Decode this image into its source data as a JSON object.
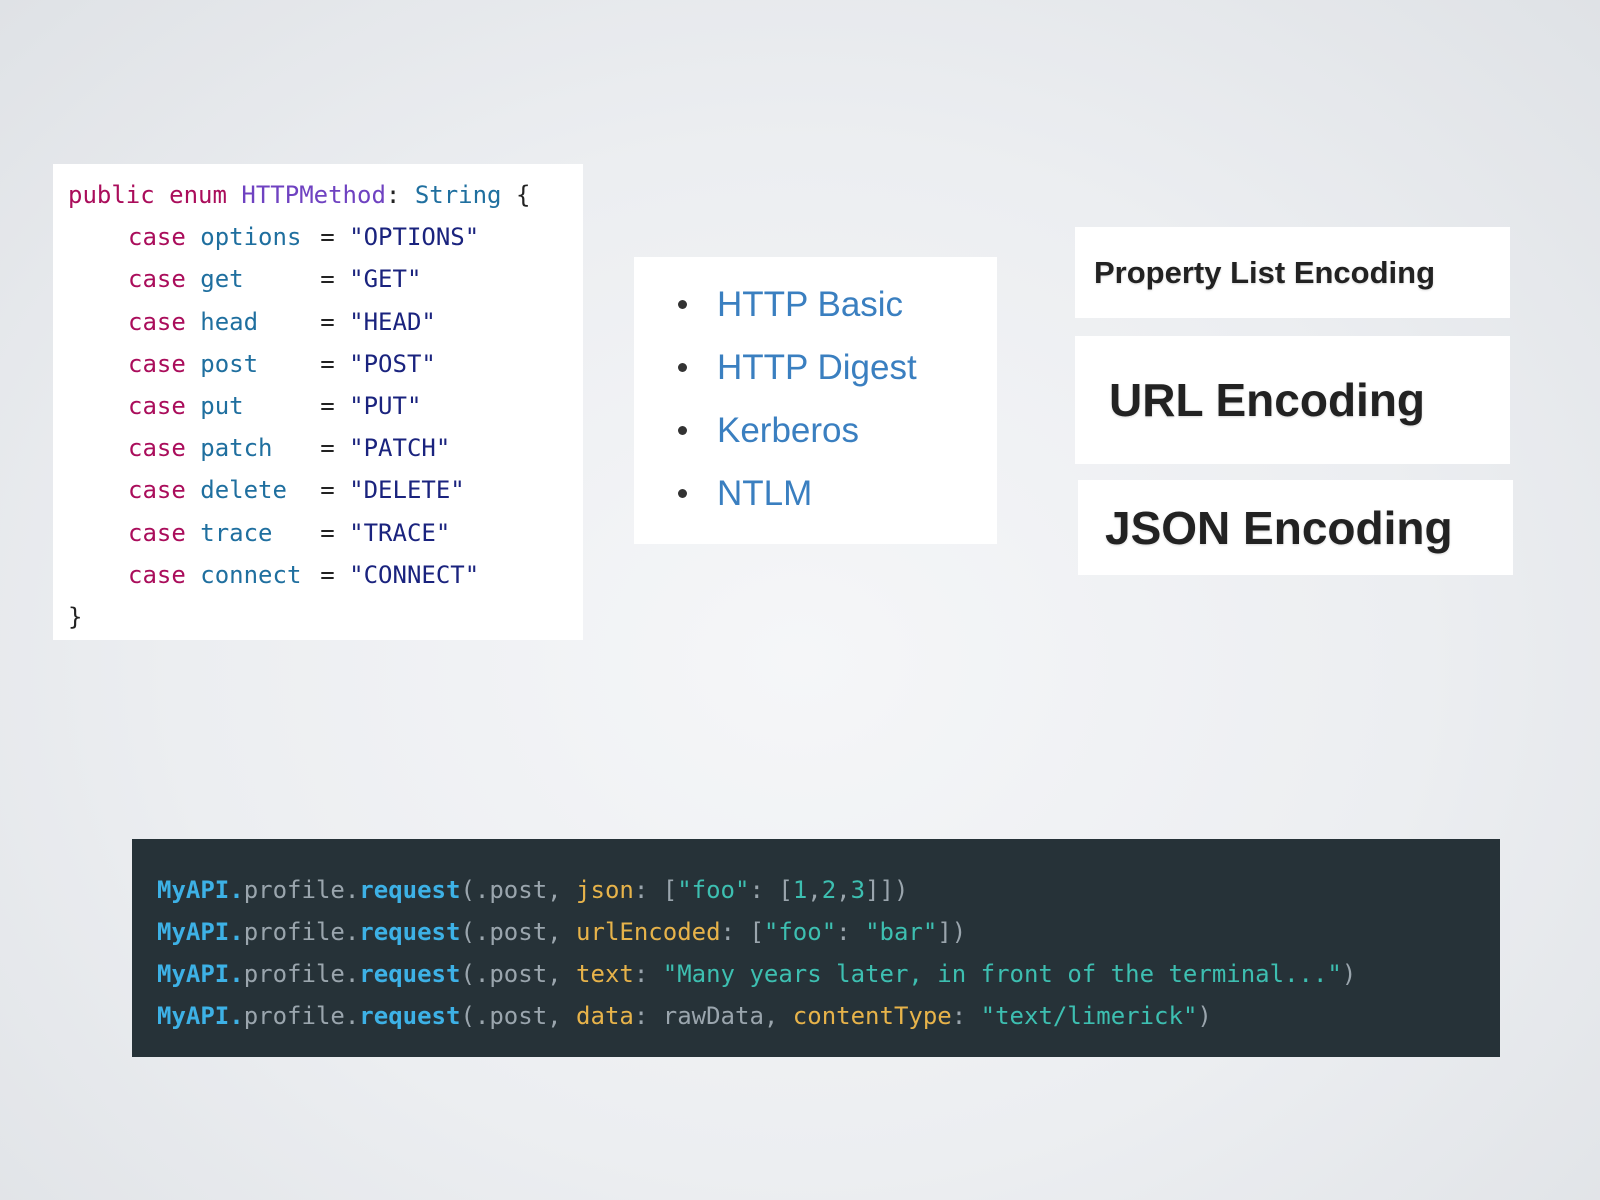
{
  "enum_code": {
    "header": {
      "kw1": "public",
      "kw2": "enum",
      "type_name": "HTTPMethod",
      "colon": ":",
      "raw_type": "String",
      "open_brace": "{"
    },
    "case_keyword": "case",
    "equals": "=",
    "cases": [
      {
        "name": "options",
        "value": "\"OPTIONS\""
      },
      {
        "name": "get",
        "value": "\"GET\""
      },
      {
        "name": "head",
        "value": "\"HEAD\""
      },
      {
        "name": "post",
        "value": "\"POST\""
      },
      {
        "name": "put",
        "value": "\"PUT\""
      },
      {
        "name": "patch",
        "value": "\"PATCH\""
      },
      {
        "name": "delete",
        "value": "\"DELETE\""
      },
      {
        "name": "trace",
        "value": "\"TRACE\""
      },
      {
        "name": "connect",
        "value": "\"CONNECT\""
      }
    ],
    "close_brace": "}"
  },
  "auth_list": {
    "items": [
      "HTTP Basic",
      "HTTP Digest",
      "Kerberos",
      "NTLM"
    ]
  },
  "encodings": {
    "plist": "Property List Encoding",
    "url": "URL Encoding",
    "json": "JSON Encoding"
  },
  "request_code": {
    "obj": "MyAPI.",
    "prop": "profile.",
    "fn": "request",
    "method_arg": "(.post, ",
    "lines": [
      {
        "label": "json",
        "rest": [
          {
            "t": "plain",
            "v": ": ["
          },
          {
            "t": "str",
            "v": "\"foo\""
          },
          {
            "t": "plain",
            "v": ": ["
          },
          {
            "t": "num",
            "v": "1"
          },
          {
            "t": "plain",
            "v": ","
          },
          {
            "t": "num",
            "v": "2"
          },
          {
            "t": "plain",
            "v": ","
          },
          {
            "t": "num",
            "v": "3"
          },
          {
            "t": "plain",
            "v": "]])"
          }
        ]
      },
      {
        "label": "urlEncoded",
        "rest": [
          {
            "t": "plain",
            "v": ": ["
          },
          {
            "t": "str",
            "v": "\"foo\""
          },
          {
            "t": "plain",
            "v": ": "
          },
          {
            "t": "str",
            "v": "\"bar\""
          },
          {
            "t": "plain",
            "v": "])"
          }
        ]
      },
      {
        "label": "text",
        "rest": [
          {
            "t": "plain",
            "v": ": "
          },
          {
            "t": "str",
            "v": "\"Many years later, in front of the terminal...\""
          },
          {
            "t": "plain",
            "v": ")"
          }
        ]
      },
      {
        "label": "data",
        "rest": [
          {
            "t": "plain",
            "v": ": rawData, "
          },
          {
            "t": "label",
            "v": "contentType"
          },
          {
            "t": "plain",
            "v": ": "
          },
          {
            "t": "str",
            "v": "\"text/limerick\""
          },
          {
            "t": "plain",
            "v": ")"
          }
        ]
      }
    ]
  },
  "colors": {
    "keyword": "#aa0d5b",
    "type": "#6f42c1",
    "link": "#3a7fc0",
    "code_bg": "#263238",
    "code_fn": "#3db1e6",
    "code_label": "#e7b34a",
    "code_string": "#3dbfb1"
  }
}
